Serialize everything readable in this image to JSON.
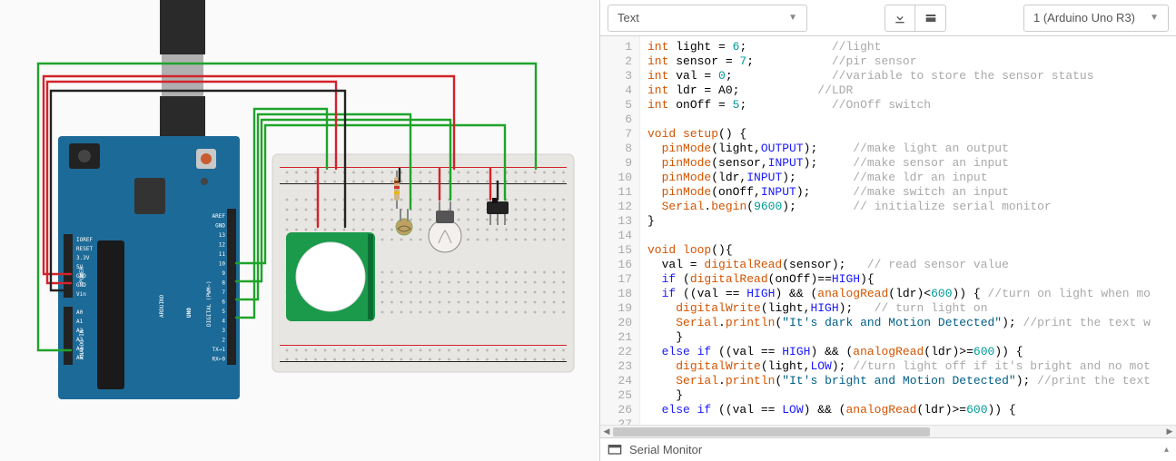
{
  "toolbar": {
    "mode_label": "Text",
    "board_label": "1 (Arduino Uno R3)",
    "download_title": "Download",
    "library_title": "Libraries"
  },
  "serial": {
    "label": "Serial Monitor"
  },
  "arduino": {
    "brand": "ARDUINO",
    "model": "UNO",
    "digital_label": "DIGITAL (PWM~)",
    "analog_label": "ANALOG IN",
    "power_label": "POWER",
    "right_pins": [
      "AREF",
      "GND",
      "13",
      "12",
      "11",
      "10",
      "9",
      "8",
      "7",
      "6",
      "5",
      "4",
      "3",
      "2",
      "TX→1",
      "RX←0"
    ],
    "left_power": [
      "IOREF",
      "RESET",
      "3.3V",
      "5V",
      "GND",
      "GND",
      "Vin"
    ],
    "left_analog": [
      "A0",
      "A1",
      "A2",
      "A3",
      "A4",
      "A5"
    ]
  },
  "code": {
    "lines": [
      {
        "n": 1,
        "tokens": [
          {
            "t": "int ",
            "c": "type"
          },
          {
            "t": "light = "
          },
          {
            "t": "6",
            "c": "num"
          },
          {
            "t": ";            "
          },
          {
            "t": "//light",
            "c": "com"
          }
        ]
      },
      {
        "n": 2,
        "tokens": [
          {
            "t": "int ",
            "c": "type"
          },
          {
            "t": "sensor = "
          },
          {
            "t": "7",
            "c": "num"
          },
          {
            "t": ";           "
          },
          {
            "t": "//pir sensor",
            "c": "com"
          }
        ]
      },
      {
        "n": 3,
        "tokens": [
          {
            "t": "int ",
            "c": "type"
          },
          {
            "t": "val = "
          },
          {
            "t": "0",
            "c": "num"
          },
          {
            "t": ";              "
          },
          {
            "t": "//variable to store the sensor status",
            "c": "com"
          }
        ]
      },
      {
        "n": 4,
        "tokens": [
          {
            "t": "int ",
            "c": "type"
          },
          {
            "t": "ldr = A0;           "
          },
          {
            "t": "//LDR",
            "c": "com"
          }
        ]
      },
      {
        "n": 5,
        "tokens": [
          {
            "t": "int ",
            "c": "type"
          },
          {
            "t": "onOff = "
          },
          {
            "t": "5",
            "c": "num"
          },
          {
            "t": ";            "
          },
          {
            "t": "//OnOff switch",
            "c": "com"
          }
        ]
      },
      {
        "n": 6,
        "tokens": [
          {
            "t": " "
          }
        ]
      },
      {
        "n": 7,
        "tokens": [
          {
            "t": "void ",
            "c": "type"
          },
          {
            "t": "setup",
            "c": "fn"
          },
          {
            "t": "() {"
          }
        ]
      },
      {
        "n": 8,
        "tokens": [
          {
            "t": "  "
          },
          {
            "t": "pinMode",
            "c": "fn"
          },
          {
            "t": "(light,"
          },
          {
            "t": "OUTPUT",
            "c": "const"
          },
          {
            "t": ");     "
          },
          {
            "t": "//make light an output",
            "c": "com"
          }
        ]
      },
      {
        "n": 9,
        "tokens": [
          {
            "t": "  "
          },
          {
            "t": "pinMode",
            "c": "fn"
          },
          {
            "t": "(sensor,"
          },
          {
            "t": "INPUT",
            "c": "const"
          },
          {
            "t": ");     "
          },
          {
            "t": "//make sensor an input",
            "c": "com"
          }
        ]
      },
      {
        "n": 10,
        "tokens": [
          {
            "t": "  "
          },
          {
            "t": "pinMode",
            "c": "fn"
          },
          {
            "t": "(ldr,"
          },
          {
            "t": "INPUT",
            "c": "const"
          },
          {
            "t": ");        "
          },
          {
            "t": "//make ldr an input",
            "c": "com"
          }
        ]
      },
      {
        "n": 11,
        "tokens": [
          {
            "t": "  "
          },
          {
            "t": "pinMode",
            "c": "fn"
          },
          {
            "t": "(onOff,"
          },
          {
            "t": "INPUT",
            "c": "const"
          },
          {
            "t": ");      "
          },
          {
            "t": "//make switch an input",
            "c": "com"
          }
        ]
      },
      {
        "n": 12,
        "tokens": [
          {
            "t": "  "
          },
          {
            "t": "Serial",
            "c": "sys"
          },
          {
            "t": "."
          },
          {
            "t": "begin",
            "c": "fn"
          },
          {
            "t": "("
          },
          {
            "t": "9600",
            "c": "num"
          },
          {
            "t": ");        "
          },
          {
            "t": "// initialize serial monitor",
            "c": "com"
          }
        ]
      },
      {
        "n": 13,
        "tokens": [
          {
            "t": "}"
          }
        ]
      },
      {
        "n": 14,
        "tokens": [
          {
            "t": " "
          }
        ]
      },
      {
        "n": 15,
        "tokens": [
          {
            "t": "void ",
            "c": "type"
          },
          {
            "t": "loop",
            "c": "fn"
          },
          {
            "t": "(){"
          }
        ]
      },
      {
        "n": 16,
        "tokens": [
          {
            "t": "  val = "
          },
          {
            "t": "digitalRead",
            "c": "fn"
          },
          {
            "t": "(sensor);   "
          },
          {
            "t": "// read sensor value",
            "c": "com"
          }
        ]
      },
      {
        "n": 17,
        "tokens": [
          {
            "t": "  "
          },
          {
            "t": "if ",
            "c": "kw"
          },
          {
            "t": "("
          },
          {
            "t": "digitalRead",
            "c": "fn"
          },
          {
            "t": "(onOff)=="
          },
          {
            "t": "HIGH",
            "c": "const"
          },
          {
            "t": "){"
          }
        ]
      },
      {
        "n": 18,
        "tokens": [
          {
            "t": "  "
          },
          {
            "t": "if ",
            "c": "kw"
          },
          {
            "t": "((val == "
          },
          {
            "t": "HIGH",
            "c": "const"
          },
          {
            "t": ") && ("
          },
          {
            "t": "analogRead",
            "c": "fn"
          },
          {
            "t": "(ldr)<"
          },
          {
            "t": "600",
            "c": "num"
          },
          {
            "t": ")) { "
          },
          {
            "t": "//turn on light when mo",
            "c": "com"
          }
        ]
      },
      {
        "n": 19,
        "tokens": [
          {
            "t": "    "
          },
          {
            "t": "digitalWrite",
            "c": "fn"
          },
          {
            "t": "(light,"
          },
          {
            "t": "HIGH",
            "c": "const"
          },
          {
            "t": ");   "
          },
          {
            "t": "// turn light on",
            "c": "com"
          }
        ]
      },
      {
        "n": 20,
        "tokens": [
          {
            "t": "    "
          },
          {
            "t": "Serial",
            "c": "sys"
          },
          {
            "t": "."
          },
          {
            "t": "println",
            "c": "fn"
          },
          {
            "t": "("
          },
          {
            "t": "\"It's dark and Motion Detected\"",
            "c": "str"
          },
          {
            "t": "); "
          },
          {
            "t": "//print the text w",
            "c": "com"
          }
        ]
      },
      {
        "n": 21,
        "tokens": [
          {
            "t": "    }"
          }
        ]
      },
      {
        "n": 22,
        "tokens": [
          {
            "t": "  "
          },
          {
            "t": "else if ",
            "c": "kw"
          },
          {
            "t": "((val == "
          },
          {
            "t": "HIGH",
            "c": "const"
          },
          {
            "t": ") && ("
          },
          {
            "t": "analogRead",
            "c": "fn"
          },
          {
            "t": "(ldr)>="
          },
          {
            "t": "600",
            "c": "num"
          },
          {
            "t": ")) {"
          }
        ]
      },
      {
        "n": 23,
        "tokens": [
          {
            "t": "    "
          },
          {
            "t": "digitalWrite",
            "c": "fn"
          },
          {
            "t": "(light,"
          },
          {
            "t": "LOW",
            "c": "const"
          },
          {
            "t": "); "
          },
          {
            "t": "//turn light off if it's bright and no mot",
            "c": "com"
          }
        ]
      },
      {
        "n": 24,
        "tokens": [
          {
            "t": "    "
          },
          {
            "t": "Serial",
            "c": "sys"
          },
          {
            "t": "."
          },
          {
            "t": "println",
            "c": "fn"
          },
          {
            "t": "("
          },
          {
            "t": "\"It's bright and Motion Detected\"",
            "c": "str"
          },
          {
            "t": "); "
          },
          {
            "t": "//print the text",
            "c": "com"
          }
        ]
      },
      {
        "n": 25,
        "tokens": [
          {
            "t": "    }"
          }
        ]
      },
      {
        "n": 26,
        "tokens": [
          {
            "t": "  "
          },
          {
            "t": "else if ",
            "c": "kw"
          },
          {
            "t": "((val == "
          },
          {
            "t": "LOW",
            "c": "const"
          },
          {
            "t": ") && ("
          },
          {
            "t": "analogRead",
            "c": "fn"
          },
          {
            "t": "(ldr)>="
          },
          {
            "t": "600",
            "c": "num"
          },
          {
            "t": ")) {"
          }
        ]
      },
      {
        "n": 27,
        "tokens": [
          {
            "t": " "
          }
        ]
      }
    ]
  }
}
